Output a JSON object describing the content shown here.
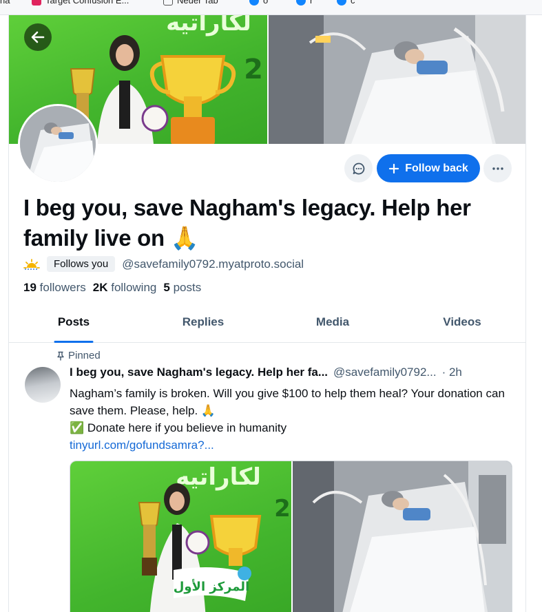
{
  "bookmarks": [
    {
      "label": "na",
      "color": "#ffffff"
    },
    {
      "label": "Target Confusion E...",
      "color": "#e0245e"
    },
    {
      "label": "Neuer Tab",
      "color": "#555555"
    },
    {
      "label": "o",
      "color": "#1185fe"
    },
    {
      "label": "r",
      "color": "#1185fe"
    },
    {
      "label": "c",
      "color": "#1185fe"
    }
  ],
  "banner": {
    "left_image": "trophy-photo",
    "right_image": "hospital-photo",
    "arabic_text": "لكاراتيه",
    "arabic_number": "2"
  },
  "profile": {
    "display_name": "I beg you, save Nagham's legacy. Help her family live on 🙏",
    "follows_you": "Follows you",
    "handle": "@savefamily0792.myatproto.social",
    "followers_count": "19",
    "followers_label": "followers",
    "following_count": "2K",
    "following_label": "following",
    "posts_count": "5",
    "posts_label": "posts"
  },
  "actions": {
    "follow_back": "Follow back"
  },
  "tabs": [
    {
      "label": "Posts",
      "active": true
    },
    {
      "label": "Replies",
      "active": false
    },
    {
      "label": "Media",
      "active": false
    },
    {
      "label": "Videos",
      "active": false
    }
  ],
  "post": {
    "pinned_label": "Pinned",
    "author": "I beg you, save Nagham's legacy. Help her fa...",
    "handle": "@savefamily0792...",
    "time": "· 2h",
    "line1": "Nagham’s family is broken. Will you give $100 to help them heal? Your donation can save them. Please, help. 🙏",
    "line2": "✅ Donate here if you believe in humanity",
    "link": "tinyurl.com/gofundsamra?...",
    "media_arabic_text": "لكاراتيه",
    "media_number": "2",
    "media_badge": "المركز الأول"
  },
  "colors": {
    "accent": "#0f70ec",
    "muted": "#42576c",
    "link": "#1469d6"
  }
}
